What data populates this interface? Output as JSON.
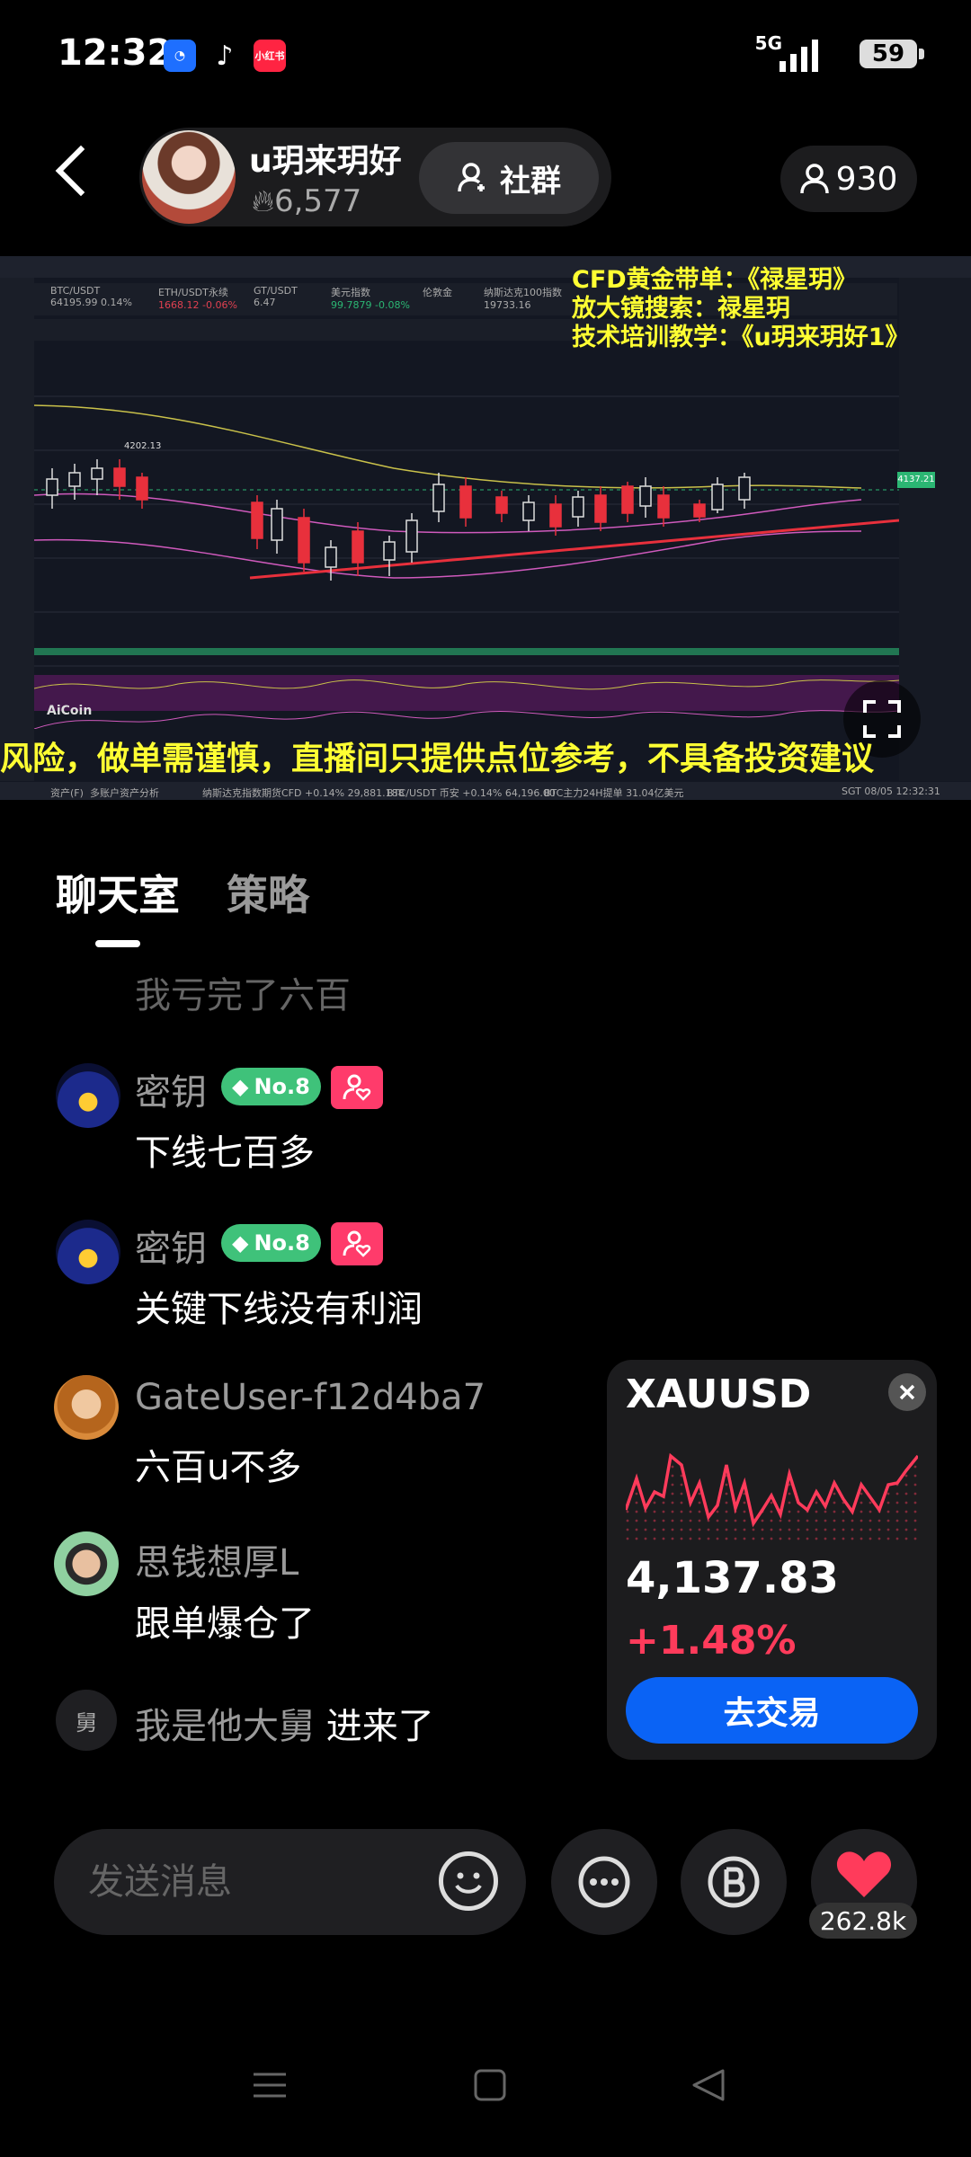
{
  "status_bar": {
    "time": "12:32",
    "network": "5G",
    "battery": "59",
    "app_icons": [
      "blue-app-icon",
      "tiktok-icon",
      "xiaohongshu-icon"
    ],
    "xhs_label": "小红书"
  },
  "header": {
    "host_name": "u玥来玥好",
    "fans_count": "6,577",
    "community_label": "社群",
    "viewer_count": "930"
  },
  "stream": {
    "overlay_lines": [
      "CFD黄金带单：《禄星玥》",
      "放大镜搜索：禄星玥",
      "技术培训教学：《u玥来玥好1》"
    ],
    "scroll_text": "风险，做单需谨慎，直播间只提供点位参考，不具备投资建议",
    "aicoin_label": "AiCoin",
    "chart_tickers": [
      {
        "name": "BTC/USDT",
        "value": "64195.99 0.14%"
      },
      {
        "name": "ETH/USDT永续",
        "value": "1668.12 -0.06%"
      },
      {
        "name": "GT/USDT",
        "value": "6.47"
      },
      {
        "name": "美元指数",
        "value": "99.7879 -0.08%"
      },
      {
        "name": "伦敦金",
        "value": ""
      },
      {
        "name": "纳斯达克100指数",
        "value": "19733.16"
      }
    ],
    "chart_label_high": "4202.13",
    "price_tag": "4137.21",
    "footer_items": [
      "资产(F)",
      "多账户资产分析",
      "纳斯达克指数期货CFD +0.14% 29,881.188",
      "BTC/USDT 币安 +0.14% 64,196.00",
      "BTC主力24H提单 31.04亿美元",
      "SGT 08/05 12:32:31"
    ]
  },
  "tabs": {
    "chat": "聊天室",
    "strategy": "策略"
  },
  "chat": {
    "faded_message": "我亏完了六百",
    "messages": [
      {
        "user": "密钥",
        "badge": "No.8",
        "text": "下线七百多"
      },
      {
        "user": "密钥",
        "badge": "No.8",
        "text": "关键下线没有利润"
      },
      {
        "user": "GateUser-f12d4ba7",
        "text": "六百u不多"
      },
      {
        "user": "思钱想厚L",
        "text": "跟单爆仓了"
      }
    ],
    "join": {
      "avatar_char": "舅",
      "user": "我是他大舅",
      "action": "进来了"
    }
  },
  "market_card": {
    "symbol": "XAUUSD",
    "price": "4,137.83",
    "change": "+1.48%",
    "trade_button": "去交易",
    "line_color": "#ff3b5b"
  },
  "bottom_bar": {
    "input_placeholder": "发送消息",
    "like_count": "262.8k"
  },
  "colors": {
    "accent_blue": "#0a63f5",
    "heart_red": "#ff3b5b",
    "badge_green": "#3fc27a",
    "overlay_yellow": "#ffff33"
  }
}
